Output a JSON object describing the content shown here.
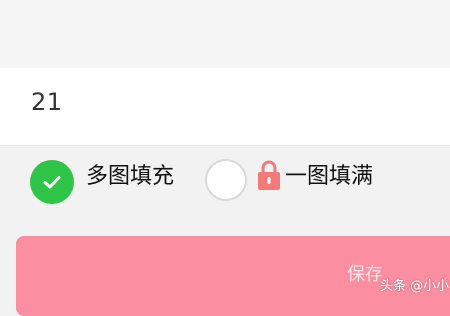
{
  "input": {
    "value": "21"
  },
  "options": [
    {
      "label": "多图填充",
      "selected": true,
      "locked": false
    },
    {
      "label": "一图填满",
      "selected": false,
      "locked": true
    }
  ],
  "save_button": {
    "label": "保存"
  },
  "watermark": {
    "text": "头条 @小小"
  },
  "colors": {
    "selected_radio": "#2ec447",
    "lock": "#f37a7a",
    "save_button": "#fb8fa1"
  },
  "icons": {
    "selected": "check-icon",
    "locked": "lock-icon"
  }
}
